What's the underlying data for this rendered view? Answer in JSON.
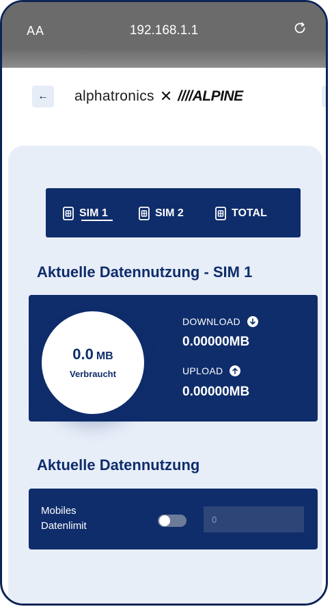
{
  "browser": {
    "aa_label": "AA",
    "url": "192.168.1.1"
  },
  "header": {
    "back_glyph": "←",
    "logo_left": "alphatronics",
    "logo_x": "✕",
    "logo_right": "////ALPINE",
    "menu_glyph": "≡"
  },
  "tabs": [
    {
      "label": "SIM 1",
      "active": true
    },
    {
      "label": "SIM 2",
      "active": false
    },
    {
      "label": "TOTAL",
      "active": false
    }
  ],
  "current_usage": {
    "title": "Aktuelle Datennutzung - SIM 1",
    "used_value": "0.0",
    "used_unit": "MB",
    "used_label": "Verbraucht",
    "download_label": "DOWNLOAD",
    "download_value": "0.00000MB",
    "upload_label": "UPLOAD",
    "upload_value": "0.00000MB"
  },
  "limit_section": {
    "title": "Aktuelle Datennutzung",
    "label_line1": "Mobiles",
    "label_line2": "Datenlimit",
    "toggle_on": false,
    "input_placeholder": "0"
  },
  "colors": {
    "navy": "#0f2d6b",
    "panel": "#e8eef8",
    "urlbar": "#6b6b6b"
  }
}
